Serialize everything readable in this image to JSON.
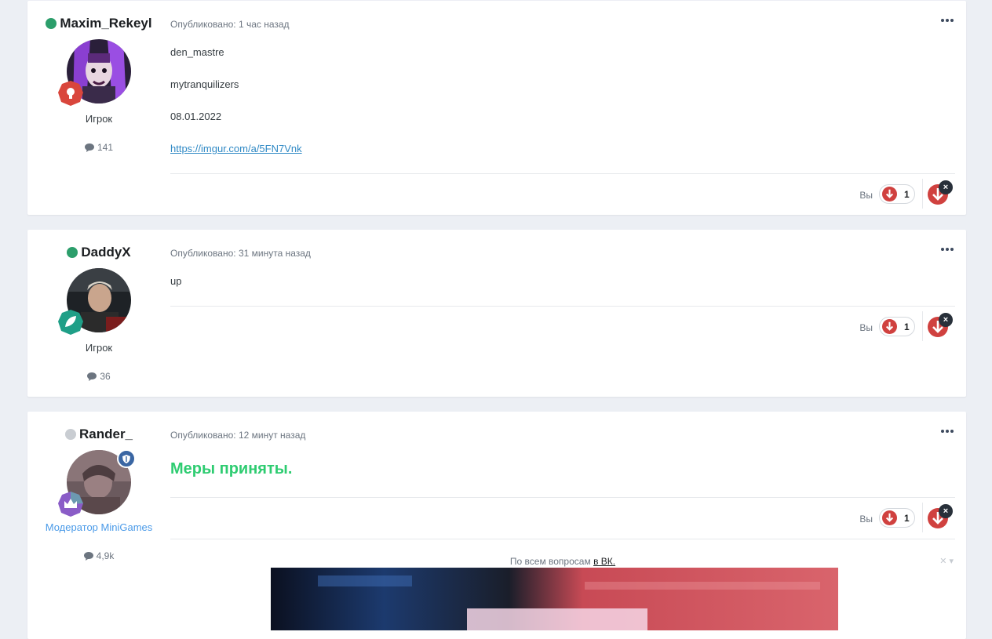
{
  "posts": [
    {
      "author": "Maxim_Rekeyl",
      "status": "online",
      "group": "Игрок",
      "post_count": "141",
      "published": "Опубликовано: 1 час назад",
      "lines": [
        "den_mastre",
        "mytranquilizers",
        "08.01.2022"
      ],
      "link": "https://imgur.com/a/5FN7Vnk",
      "you_label": "Вы",
      "reaction_count": "1",
      "rank_color": "#d9463c"
    },
    {
      "author": "DaddyX",
      "status": "online",
      "group": "Игрок",
      "post_count": "36",
      "published": "Опубликовано: 31 минута назад",
      "lines": [
        "up"
      ],
      "you_label": "Вы",
      "reaction_count": "1",
      "rank_color": "#1f9f87"
    },
    {
      "author": "Rander_",
      "status": "offline",
      "group": "Модератор MiniGames",
      "post_count": "4,9k",
      "published": "Опубликовано: 12 минут назад",
      "headline": "Меры приняты.",
      "you_label": "Вы",
      "reaction_count": "1",
      "rank_color": "#8a5cc7",
      "signature_text": "По всем вопросам",
      "signature_link": "в ВК."
    }
  ],
  "colors": {
    "online": "#2c9e6b",
    "offline": "#c9cdd2",
    "reaction": "#d0413f",
    "link": "#2f89c5",
    "headline": "#2ecc71"
  },
  "icons": {
    "more": "more-dots-icon",
    "comments": "comment-bubble-icon",
    "reaction": "thumbs-down-arrow-icon",
    "close": "close-icon"
  }
}
